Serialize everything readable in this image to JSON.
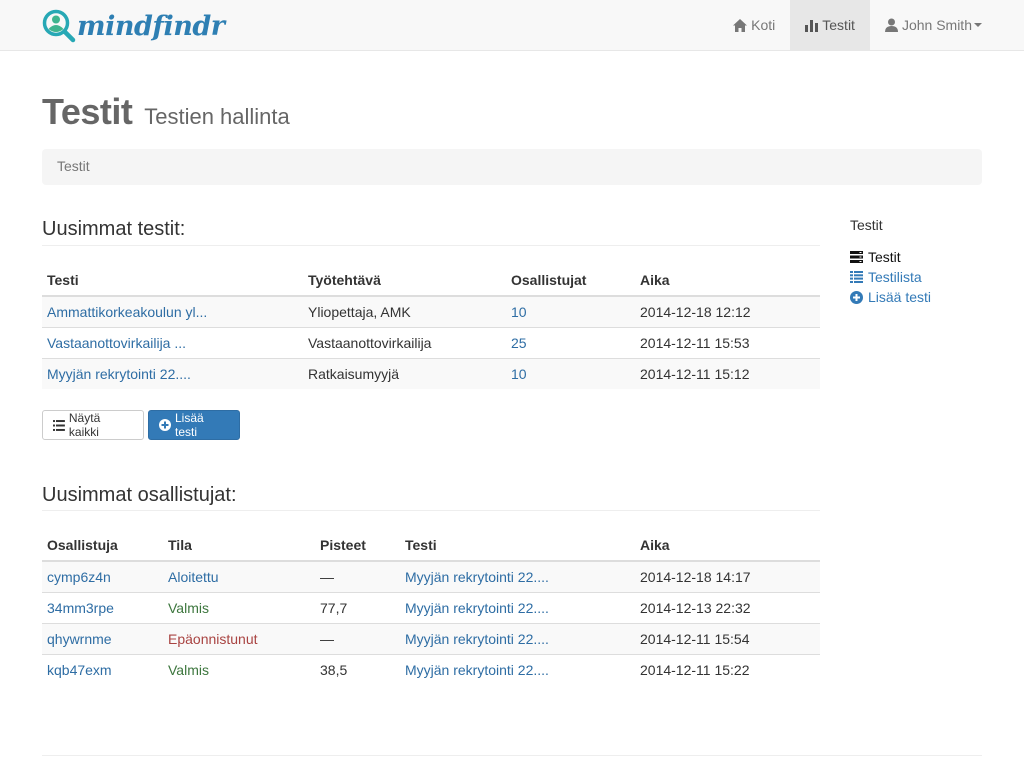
{
  "brand": {
    "name": "mindfindr"
  },
  "nav": {
    "items": [
      {
        "label": "Koti",
        "icon": "home-icon",
        "active": false
      },
      {
        "label": "Testit",
        "icon": "bar-chart-icon",
        "active": true
      },
      {
        "label": "John Smith",
        "icon": "user-icon",
        "active": false,
        "dropdown": true
      }
    ]
  },
  "header": {
    "title": "Testit",
    "subtitle": "Testien hallinta"
  },
  "breadcrumb": {
    "current": "Testit"
  },
  "latest_tests": {
    "heading": "Uusimmat testit:",
    "columns": [
      "Testi",
      "Työtehtävä",
      "Osallistujat",
      "Aika"
    ],
    "rows": [
      {
        "test": "Ammattikorkeakoulun yl...",
        "job": "Yliopettaja, AMK",
        "participants": "10",
        "time": "2014-12-18 12:12"
      },
      {
        "test": "Vastaanottovirkailija ...",
        "job": "Vastaanottovirkailija",
        "participants": "25",
        "time": "2014-12-11 15:53"
      },
      {
        "test": "Myyjän rekrytointi 22....",
        "job": "Ratkaisumyyjä",
        "participants": "10",
        "time": "2014-12-11 15:12"
      }
    ],
    "show_all_label": "Näytä kaikki",
    "add_test_label": "Lisää testi"
  },
  "latest_participants": {
    "heading": "Uusimmat osallistujat:",
    "columns": [
      "Osallistuja",
      "Tila",
      "Pisteet",
      "Testi",
      "Aika"
    ],
    "rows": [
      {
        "id": "cymp6z4n",
        "status": "Aloitettu",
        "status_type": "blue",
        "score": "—",
        "test": "Myyjän rekrytointi 22....",
        "time": "2014-12-18 14:17"
      },
      {
        "id": "34mm3rpe",
        "status": "Valmis",
        "status_type": "green",
        "score": "77,7",
        "test": "Myyjän rekrytointi 22....",
        "time": "2014-12-13 22:32"
      },
      {
        "id": "qhywrnme",
        "status": "Epäonnistunut",
        "status_type": "red",
        "score": "—",
        "test": "Myyjän rekrytointi 22....",
        "time": "2014-12-11 15:54"
      },
      {
        "id": "kqb47exm",
        "status": "Valmis",
        "status_type": "green",
        "score": "38,5",
        "test": "Myyjän rekrytointi 22....",
        "time": "2014-12-11 15:22"
      }
    ]
  },
  "sidebar": {
    "heading": "Testit",
    "items": [
      {
        "label": "Testit",
        "icon": "server-icon",
        "current": true
      },
      {
        "label": "Testilista",
        "icon": "list-icon",
        "current": false
      },
      {
        "label": "Lisää testi",
        "icon": "plus-circle-icon",
        "current": false
      }
    ]
  },
  "colors": {
    "primary": "#337ab7",
    "link": "#2e6da4",
    "success": "#3c763d",
    "danger": "#a94442",
    "info": "#31708f"
  }
}
